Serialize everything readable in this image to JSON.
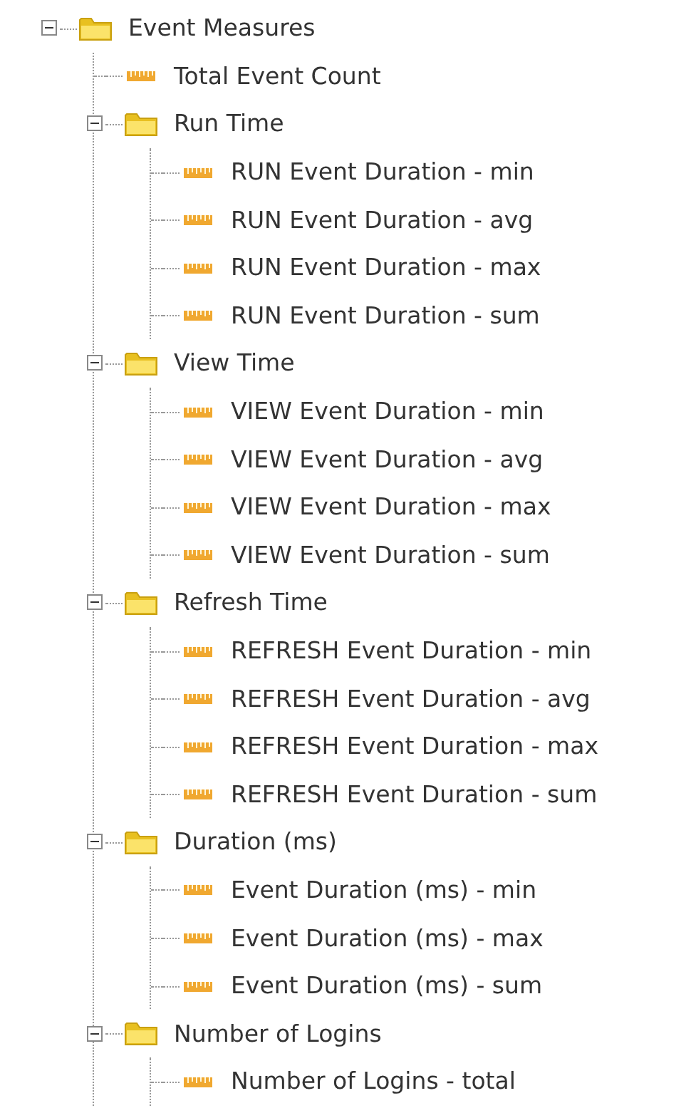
{
  "tree": [
    {
      "kind": "folder",
      "label": "Event Measures",
      "expanded": true,
      "children": [
        {
          "kind": "measure",
          "label": "Total Event Count"
        },
        {
          "kind": "folder",
          "label": "Run Time",
          "expanded": true,
          "children": [
            {
              "kind": "measure",
              "label": "RUN Event Duration - min"
            },
            {
              "kind": "measure",
              "label": "RUN Event Duration - avg"
            },
            {
              "kind": "measure",
              "label": "RUN Event Duration - max"
            },
            {
              "kind": "measure",
              "label": "RUN Event Duration - sum"
            }
          ]
        },
        {
          "kind": "folder",
          "label": "View Time",
          "expanded": true,
          "children": [
            {
              "kind": "measure",
              "label": "VIEW Event Duration - min"
            },
            {
              "kind": "measure",
              "label": "VIEW Event Duration - avg"
            },
            {
              "kind": "measure",
              "label": "VIEW Event Duration - max"
            },
            {
              "kind": "measure",
              "label": "VIEW Event Duration - sum"
            }
          ]
        },
        {
          "kind": "folder",
          "label": "Refresh Time",
          "expanded": true,
          "children": [
            {
              "kind": "measure",
              "label": "REFRESH Event Duration - min"
            },
            {
              "kind": "measure",
              "label": "REFRESH Event Duration - avg"
            },
            {
              "kind": "measure",
              "label": "REFRESH Event Duration - max"
            },
            {
              "kind": "measure",
              "label": "REFRESH Event Duration - sum"
            }
          ]
        },
        {
          "kind": "folder",
          "label": "Duration (ms)",
          "expanded": true,
          "children": [
            {
              "kind": "measure",
              "label": "Event Duration (ms) - min"
            },
            {
              "kind": "measure",
              "label": "Event Duration (ms) - max"
            },
            {
              "kind": "measure",
              "label": "Event Duration (ms) - sum"
            }
          ]
        },
        {
          "kind": "folder",
          "label": "Number of Logins",
          "expanded": true,
          "children": [
            {
              "kind": "measure",
              "label": "Number of Logins - total"
            }
          ]
        }
      ]
    }
  ]
}
